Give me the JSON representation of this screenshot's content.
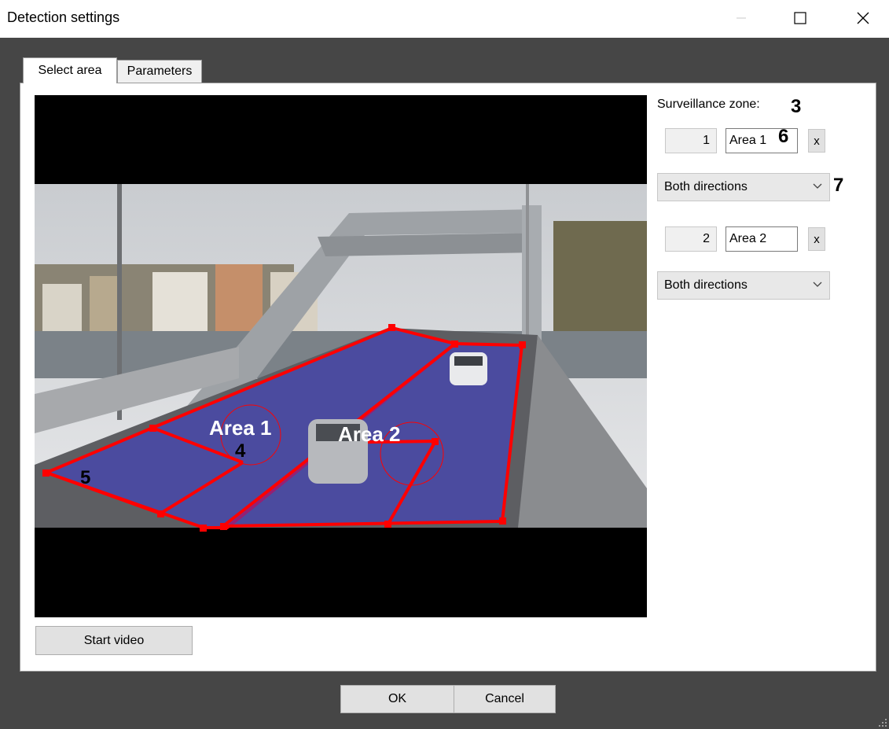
{
  "window": {
    "title": "Detection settings"
  },
  "tabs": [
    {
      "label": "Select area",
      "active": true
    },
    {
      "label": "Parameters",
      "active": false
    }
  ],
  "video": {
    "overlay_labels": [
      "Area 1",
      "Area 2"
    ],
    "callouts": [
      "4",
      "5"
    ],
    "zone_color": "#3c3cd2",
    "line_color": "#ff0000",
    "scene": "bridge-with-cars-icon"
  },
  "zone_panel": {
    "label": "Surveillance zone:",
    "label_callout": "3",
    "zones": [
      {
        "number": "1",
        "name": "Area 1",
        "direction": "Both directions",
        "name_callout": "6",
        "direction_callout": "7",
        "delete": "x"
      },
      {
        "number": "2",
        "name": "Area 2",
        "direction": "Both directions",
        "delete": "x"
      }
    ]
  },
  "buttons": {
    "start_video": "Start video",
    "ok": "OK",
    "cancel": "Cancel"
  }
}
